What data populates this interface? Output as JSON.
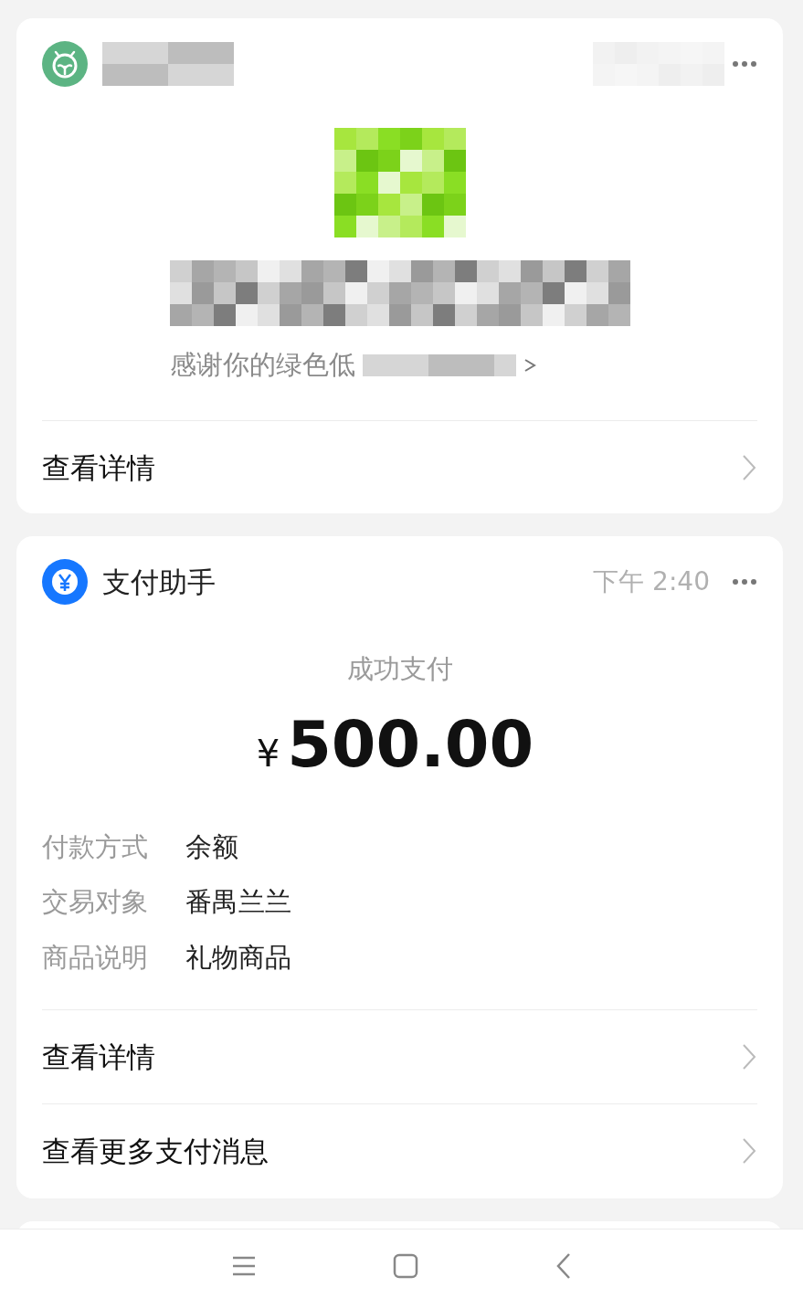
{
  "notice_card": {
    "message": "感谢你的绿色低",
    "link": "查看详情"
  },
  "payment_card": {
    "sender": "支付助手",
    "time": "下午 2:40",
    "status": "成功支付",
    "currency": "¥",
    "amount": "500.00",
    "details": [
      {
        "label": "付款方式",
        "value": "余额"
      },
      {
        "label": "交易对象",
        "value": "番禺兰兰"
      },
      {
        "label": "商品说明",
        "value": "礼物商品"
      }
    ],
    "links": [
      "查看详情",
      "查看更多支付消息"
    ]
  }
}
